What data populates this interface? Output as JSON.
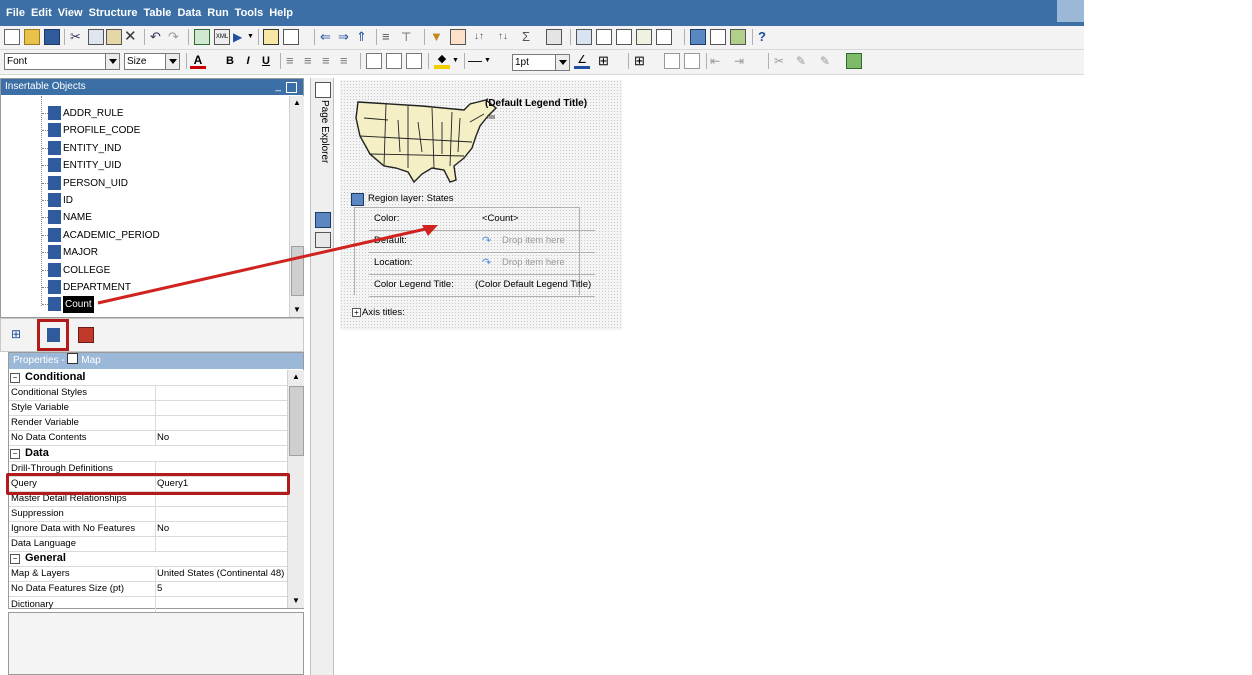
{
  "menu": [
    "File",
    "Edit",
    "View",
    "Structure",
    "Table",
    "Data",
    "Run",
    "Tools",
    "Help"
  ],
  "toolbar2": {
    "font_value": "Font",
    "size_value": "Size",
    "line_weight_value": "1pt"
  },
  "insertable": {
    "title": "Insertable Objects",
    "items": [
      {
        "label": "ADDR_RULE"
      },
      {
        "label": "PROFILE_CODE"
      },
      {
        "label": "ENTITY_IND"
      },
      {
        "label": "ENTITY_UID"
      },
      {
        "label": "PERSON_UID"
      },
      {
        "label": "ID"
      },
      {
        "label": "NAME"
      },
      {
        "label": "ACADEMIC_PERIOD"
      },
      {
        "label": "MAJOR"
      },
      {
        "label": "COLLEGE"
      },
      {
        "label": "DEPARTMENT"
      },
      {
        "label": "Count",
        "selected": true
      }
    ]
  },
  "properties": {
    "title": "Properties",
    "context": "Map",
    "rows": [
      {
        "type": "section",
        "name": "Conditional"
      },
      {
        "name": "Conditional Styles",
        "value": ""
      },
      {
        "name": "Style Variable",
        "value": ""
      },
      {
        "name": "Render Variable",
        "value": ""
      },
      {
        "name": "No Data Contents",
        "value": "No"
      },
      {
        "type": "section",
        "name": "Data"
      },
      {
        "name": "Drill-Through Definitions",
        "value": ""
      },
      {
        "name": "Query",
        "value": "Query1",
        "highlight": true
      },
      {
        "name": "Master Detail Relationships",
        "value": ""
      },
      {
        "name": "Suppression",
        "value": ""
      },
      {
        "name": "Ignore Data with No Features",
        "value": "No"
      },
      {
        "name": "Data Language",
        "value": ""
      },
      {
        "type": "section",
        "name": "General"
      },
      {
        "name": "Map & Layers",
        "value": "United States (Continental 48)"
      },
      {
        "name": "No Data Features Size (pt)",
        "value": "5"
      },
      {
        "name": "Dictionary",
        "value": ""
      }
    ]
  },
  "page_explorer": {
    "label": "Page Explorer"
  },
  "map": {
    "legend_title": "(Default Legend Title)",
    "region_layer": "Region layer: States",
    "rows": [
      {
        "key": "Color:",
        "value": "<Count>"
      },
      {
        "key": "Default:",
        "value": "Drop item here"
      },
      {
        "key": "Location:",
        "value": "Drop item here"
      },
      {
        "key": "Color Legend Title:",
        "value": "(Color Default Legend Title)"
      }
    ],
    "axis_titles": "Axis titles:"
  },
  "colors": {
    "title_bar": "#3b6fa6",
    "highlight_box": "#b31b1b",
    "arrow": "#d0231f",
    "map_land": "#f4efc5"
  }
}
